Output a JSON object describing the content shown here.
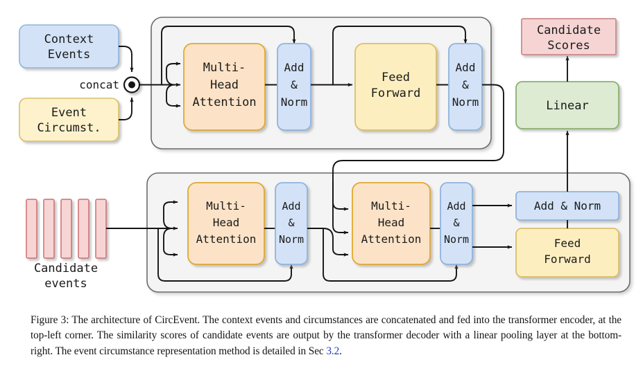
{
  "figure": {
    "title": "The architecture of CircEvent",
    "inputs": {
      "context_events": {
        "label": "Context\nEvents",
        "line1": "Context",
        "line2": "Events",
        "fill": "#d3e2f7",
        "stroke": "#8fb4dd"
      },
      "event_circumstances": {
        "label": "Event\nCircumst.",
        "line1": "Event",
        "line2": "Circumst.",
        "fill": "#fdf2cc",
        "stroke": "#d9bf6a"
      },
      "concat": {
        "label": "concat"
      },
      "candidate_events": {
        "line1": "Candidate",
        "line2": "events",
        "fill": "#f8d5d5",
        "stroke": "#cc6f6f",
        "bar_count": 5
      }
    },
    "encoder": {
      "name": "transformer-encoder",
      "blocks": [
        {
          "id": "enc-mha",
          "lines": [
            "Multi-",
            "Head",
            "Attention"
          ],
          "fill": "#fce3c7",
          "stroke": "#e0a82e"
        },
        {
          "id": "enc-addnorm-1",
          "lines": [
            "Add",
            "&",
            "Norm"
          ],
          "fill": "#d3e2f7",
          "stroke": "#8fb4dd"
        },
        {
          "id": "enc-ff",
          "lines": [
            "Feed",
            "Forward"
          ],
          "fill": "#fdeec0",
          "stroke": "#d9bf6a"
        },
        {
          "id": "enc-addnorm-2",
          "lines": [
            "Add",
            "&",
            "Norm"
          ],
          "fill": "#d3e2f7",
          "stroke": "#8fb4dd"
        }
      ]
    },
    "decoder": {
      "name": "transformer-decoder",
      "blocks": [
        {
          "id": "dec-mha-self",
          "lines": [
            "Multi-",
            "Head",
            "Attention"
          ],
          "fill": "#fce3c7",
          "stroke": "#e0a82e"
        },
        {
          "id": "dec-addnorm-1",
          "lines": [
            "Add",
            "&",
            "Norm"
          ],
          "fill": "#d3e2f7",
          "stroke": "#8fb4dd"
        },
        {
          "id": "dec-mha-cross",
          "lines": [
            "Multi-",
            "Head",
            "Attention"
          ],
          "fill": "#fce3c7",
          "stroke": "#e0a82e"
        },
        {
          "id": "dec-addnorm-2",
          "lines": [
            "Add",
            "&",
            "Norm"
          ],
          "fill": "#d3e2f7",
          "stroke": "#8fb4dd"
        },
        {
          "id": "dec-addnorm-3",
          "lines": [
            "Add & Norm"
          ],
          "fill": "#d3e2f7",
          "stroke": "#8fb4dd"
        },
        {
          "id": "dec-ff",
          "lines": [
            "Feed",
            "Forward"
          ],
          "fill": "#fdeec0",
          "stroke": "#d9bf6a"
        }
      ]
    },
    "output": {
      "linear": {
        "label": "Linear",
        "fill": "#dcebd2",
        "stroke": "#8ab06f"
      },
      "candidate_scores": {
        "line1": "Candidate",
        "line2": "Scores",
        "fill": "#f6d4d4",
        "stroke": "#cc8a8a"
      }
    },
    "palette": {
      "container_fill": "#f4f4f4",
      "container_stroke": "#6b6b6b",
      "arrow": "#141414",
      "text": "#1a1a1a"
    }
  },
  "caption": {
    "prefix": "Figure 3:",
    "body_part1": "The architecture of CircEvent. The context events and circumstances are concatenated and fed into the transformer encoder, at the top-left corner. The similarity scores of candidate events are output by the transformer decoder with a linear pooling layer at the bottom-right. The event circumstance representation method is detailed in Sec ",
    "section_link": "3.2",
    "body_part2": "."
  }
}
